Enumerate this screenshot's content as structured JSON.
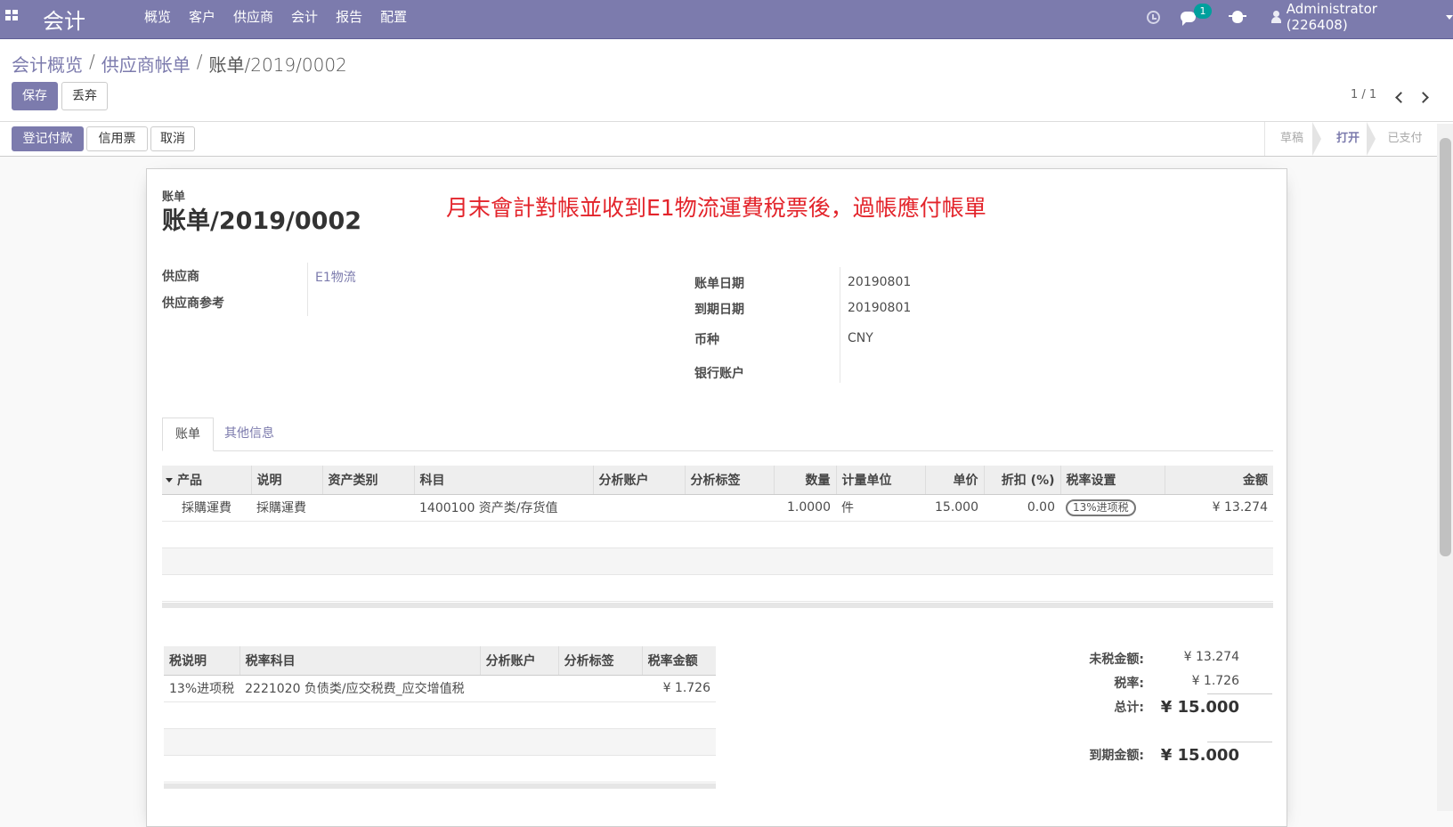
{
  "navbar": {
    "app_title": "会计",
    "menu": [
      "概览",
      "客户",
      "供应商",
      "会计",
      "报告",
      "配置"
    ],
    "messages_count": "1",
    "user": "Administrator (226408)"
  },
  "breadcrumb": [
    "会计概览",
    "供应商帐单",
    "账单/2019/0002"
  ],
  "buttons": {
    "save": "保存",
    "discard": "丢弃",
    "register_payment": "登记付款",
    "credit_note": "信用票",
    "cancel": "取消"
  },
  "pager": "1 / 1",
  "statuses": [
    "草稿",
    "打开",
    "已支付"
  ],
  "form": {
    "doc_type": "账单",
    "doc_number": "账单/2019/0002",
    "annotation": "月末會計對帳並收到E1物流運費稅票後，過帳應付帳單",
    "vendor_label": "供应商",
    "vendor": "E1物流",
    "vendor_ref_label": "供应商参考",
    "bill_date_label": "账单日期",
    "bill_date": "20190801",
    "due_date_label": "到期日期",
    "due_date": "20190801",
    "currency_label": "币种",
    "currency": "CNY",
    "bank_label": "银行账户"
  },
  "tabs": [
    "账单",
    "其他信息"
  ],
  "lines": {
    "headers": [
      "产品",
      "说明",
      "资产类别",
      "科目",
      "分析账户",
      "分析标签",
      "数量",
      "计量单位",
      "单价",
      "折扣 (%)",
      "税率设置",
      "金额"
    ],
    "rows": [
      {
        "product": "採購運費",
        "description": "採購運費",
        "asset": "",
        "account": "1400100 资产类/存货值",
        "analytic": "",
        "tags": "",
        "qty": "1.0000",
        "uom": "件",
        "price": "15.000",
        "discount": "0.00",
        "tax": "13%进项税",
        "amount": "¥ 13.274"
      }
    ]
  },
  "taxes": {
    "headers": [
      "税说明",
      "税率科目",
      "分析账户",
      "分析标签",
      "税率金额"
    ],
    "rows": [
      {
        "desc": "13%进项税",
        "account": "2221020 负债类/应交税费_应交增值税",
        "analytic": "",
        "tags": "",
        "amount": "¥ 1.726"
      }
    ]
  },
  "totals": {
    "untaxed_label": "未税金额:",
    "untaxed": "¥ 13.274",
    "tax_label": "税率:",
    "tax": "¥ 1.726",
    "total_label": "总计:",
    "total": "¥ 15.000",
    "due_label": "到期金额:",
    "due": "¥ 15.000"
  }
}
